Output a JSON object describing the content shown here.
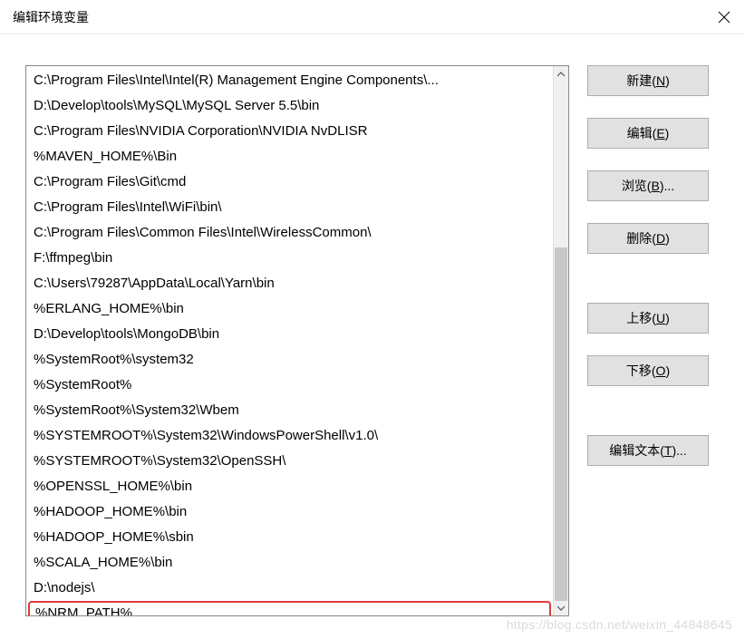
{
  "window": {
    "title": "编辑环境变量"
  },
  "list": {
    "items": [
      "C:\\Program Files\\Intel\\Intel(R) Management Engine Components\\...",
      "D:\\Develop\\tools\\MySQL\\MySQL Server 5.5\\bin",
      "C:\\Program Files\\NVIDIA Corporation\\NVIDIA NvDLISR",
      "%MAVEN_HOME%\\Bin",
      "C:\\Program Files\\Git\\cmd",
      "C:\\Program Files\\Intel\\WiFi\\bin\\",
      "C:\\Program Files\\Common Files\\Intel\\WirelessCommon\\",
      "F:\\ffmpeg\\bin",
      "C:\\Users\\79287\\AppData\\Local\\Yarn\\bin",
      "%ERLANG_HOME%\\bin",
      "D:\\Develop\\tools\\MongoDB\\bin",
      "%SystemRoot%\\system32",
      "%SystemRoot%",
      "%SystemRoot%\\System32\\Wbem",
      "%SYSTEMROOT%\\System32\\WindowsPowerShell\\v1.0\\",
      "%SYSTEMROOT%\\System32\\OpenSSH\\",
      "%OPENSSL_HOME%\\bin",
      "%HADOOP_HOME%\\bin",
      "%HADOOP_HOME%\\sbin",
      "%SCALA_HOME%\\bin",
      "D:\\nodejs\\",
      "%NRM_PATH%"
    ],
    "highlighted_index": 21
  },
  "buttons": {
    "new": {
      "full": "新建(N)",
      "text": "新建(",
      "key": "N",
      "suffix": ")"
    },
    "edit": {
      "full": "编辑(E)",
      "text": "编辑(",
      "key": "E",
      "suffix": ")"
    },
    "browse": {
      "full": "浏览(B)...",
      "text": "浏览(",
      "key": "B",
      "suffix": ")..."
    },
    "delete": {
      "full": "删除(D)",
      "text": "删除(",
      "key": "D",
      "suffix": ")"
    },
    "move_up": {
      "full": "上移(U)",
      "text": "上移(",
      "key": "U",
      "suffix": ")"
    },
    "move_down": {
      "full": "下移(O)",
      "text": "下移(",
      "key": "O",
      "suffix": ")"
    },
    "edit_text": {
      "full": "编辑文本(T)...",
      "text": "编辑文本(",
      "key": "T",
      "suffix": ")..."
    }
  },
  "watermark": "https://blog.csdn.net/weixin_44848645"
}
